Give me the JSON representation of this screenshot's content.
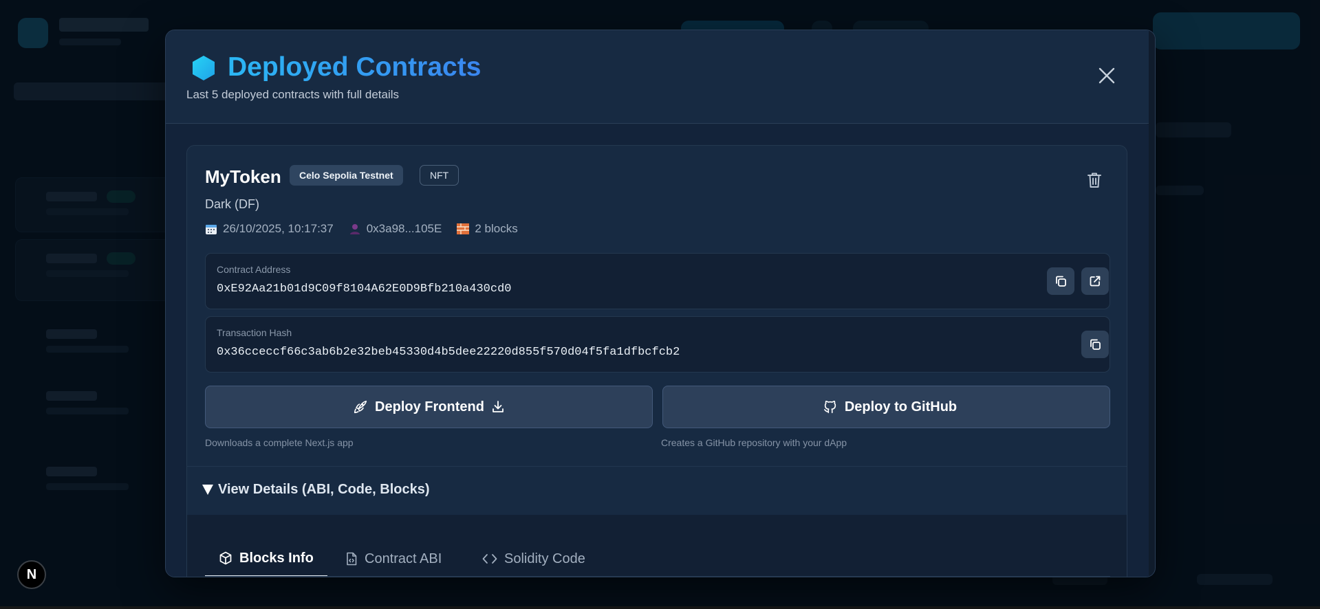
{
  "modal": {
    "title": "Deployed Contracts",
    "subtitle": "Last 5 deployed contracts with full details",
    "title_icon": "hexagon-icon",
    "close_icon": "close-icon"
  },
  "contract": {
    "name": "MyToken",
    "network_badge": "Celo Sepolia Testnet",
    "type_badge": "NFT",
    "symbol_line": "Dark (DF)",
    "meta": {
      "date": "26/10/2025, 10:17:37",
      "deployer": "0x3a98...105E",
      "blocks": "2 blocks"
    },
    "address": {
      "label": "Contract Address",
      "value": "0xE92Aa21b01d9C09f8104A62E0D9Bfb210a430cd0"
    },
    "tx": {
      "label": "Transaction Hash",
      "value": "0x36cceccf66c3ab6b2e32beb45330d4b5dee22220d855f570d04f5fa1dfbcfcb2"
    },
    "actions": {
      "deploy_frontend": "Deploy Frontend",
      "deploy_frontend_hint": "Downloads a complete Next.js app",
      "deploy_github": "Deploy to GitHub",
      "deploy_github_hint": "Creates a GitHub repository with your dApp"
    },
    "details": {
      "summary": "View Details (ABI, Code, Blocks)",
      "tabs": [
        {
          "label": "Blocks Info",
          "icon": "cube-icon",
          "active": true
        },
        {
          "label": "Contract ABI",
          "icon": "file-code-icon",
          "active": false
        },
        {
          "label": "Solidity Code",
          "icon": "code-icon",
          "active": false
        }
      ]
    }
  },
  "next_badge": "N",
  "colors": {
    "accent": "#27a7f0",
    "background": "#0a1826",
    "card": "#172a42",
    "button": "#2d405a"
  }
}
